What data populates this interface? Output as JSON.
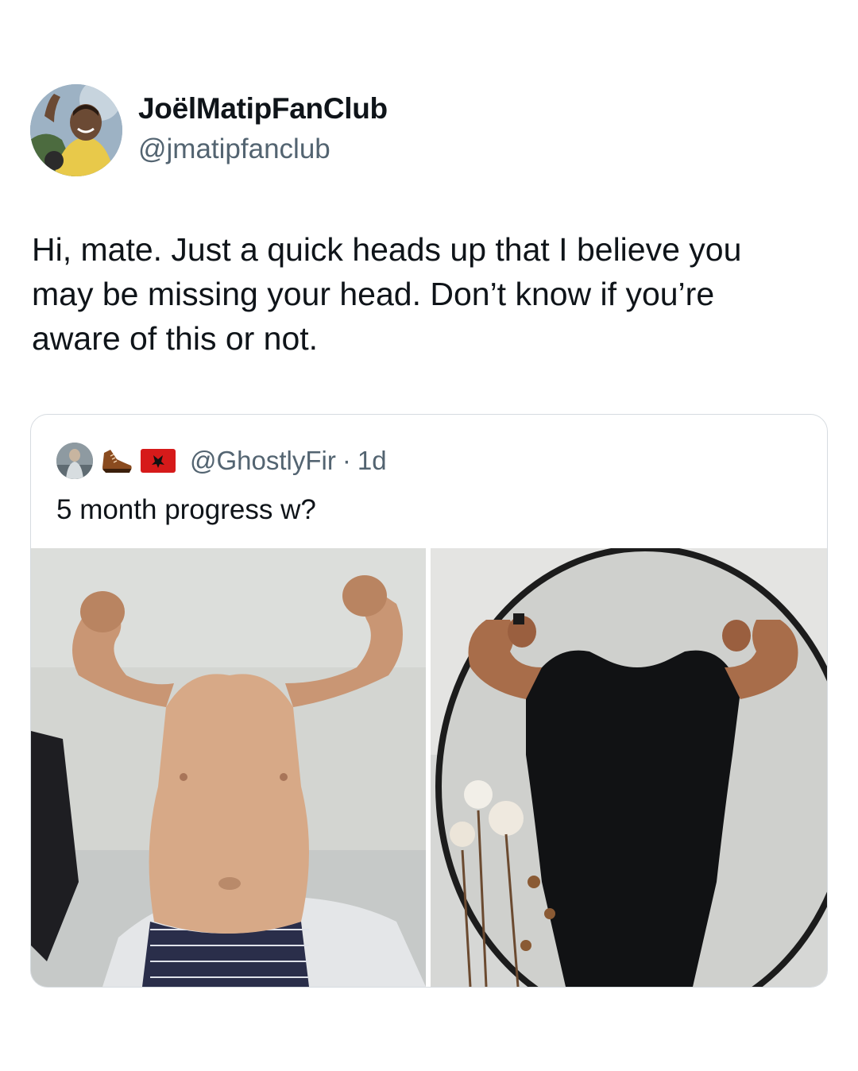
{
  "tweet": {
    "author_name": "JoëlMatipFanClub",
    "author_handle": "@jmatipfanclub",
    "text": "Hi, mate. Just a quick heads up that I believe you\nmay be missing your head. Don’t know if you’re\naware of this or not."
  },
  "quoted_tweet": {
    "handle": "@GhostlyFir",
    "separator": "·",
    "time": "1d",
    "text": "5 month progress w?",
    "header_icons": [
      "avatar",
      "shoe-icon",
      "albania-flag-icon"
    ]
  },
  "colors": {
    "text_primary": "#0f1419",
    "text_secondary": "#536471",
    "card_border": "#d6dbe0"
  }
}
